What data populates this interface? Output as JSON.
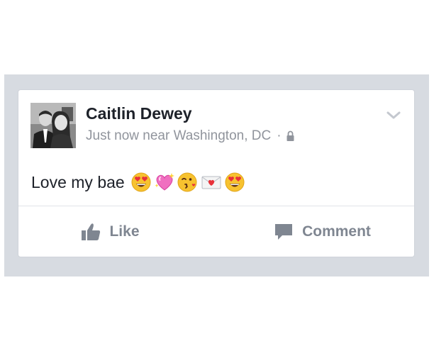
{
  "post": {
    "author": "Caitlin Dewey",
    "timestamp": "Just now",
    "location_text": "near Washington, DC",
    "separator": "·",
    "privacy_icon": "lock-icon",
    "menu_icon": "chevron-down-icon",
    "body_text": "Love my bae",
    "emojis": [
      "heart-eyes-emoji",
      "sparkling-heart-emoji",
      "kissing-face-emoji",
      "love-letter-emoji",
      "heart-eyes-emoji"
    ]
  },
  "actions": {
    "like_label": "Like",
    "like_icon": "thumbs-up-icon",
    "comment_label": "Comment",
    "comment_icon": "comment-icon"
  },
  "colors": {
    "background_band": "#d7dbe1",
    "card": "#ffffff",
    "name_text": "#1d2129",
    "meta_text": "#90949c",
    "action_text": "#7f8691"
  }
}
